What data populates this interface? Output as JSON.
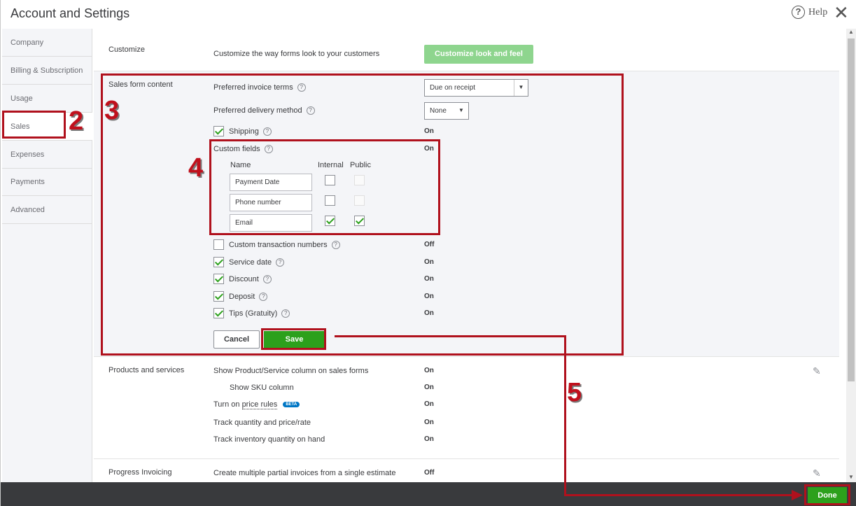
{
  "header": {
    "title": "Account and Settings",
    "help_label": "Help",
    "help_symbol": "?",
    "close_symbol": "✕"
  },
  "sidebar": {
    "items": [
      {
        "label": "Company"
      },
      {
        "label": "Billing & Subscription"
      },
      {
        "label": "Usage"
      },
      {
        "label": "Sales",
        "active": true
      },
      {
        "label": "Expenses"
      },
      {
        "label": "Payments"
      },
      {
        "label": "Advanced"
      }
    ]
  },
  "customize": {
    "section_label": "Customize",
    "description": "Customize the way forms look to your customers",
    "button_label": "Customize look and feel"
  },
  "sales_form": {
    "section_label": "Sales form content",
    "invoice_terms": {
      "label": "Preferred invoice terms",
      "value": "Due on receipt"
    },
    "delivery_method": {
      "label": "Preferred delivery method",
      "value": "None"
    },
    "shipping": {
      "label": "Shipping",
      "status": "On",
      "checked": true
    },
    "custom_fields": {
      "label": "Custom fields",
      "status": "On",
      "col_name": "Name",
      "col_internal": "Internal",
      "col_public": "Public",
      "rows": [
        {
          "name": "Payment Date",
          "internal": false,
          "public": false
        },
        {
          "name": "Phone number",
          "internal": false,
          "public": false
        },
        {
          "name": "Email",
          "internal": true,
          "public": true
        }
      ]
    },
    "options": [
      {
        "label": "Custom transaction numbers",
        "status": "Off",
        "checked": false
      },
      {
        "label": "Service date",
        "status": "On",
        "checked": true
      },
      {
        "label": "Discount",
        "status": "On",
        "checked": true
      },
      {
        "label": "Deposit",
        "status": "On",
        "checked": true
      },
      {
        "label": "Tips (Gratuity)",
        "status": "On",
        "checked": true
      }
    ],
    "cancel_label": "Cancel",
    "save_label": "Save"
  },
  "products": {
    "section_label": "Products and services",
    "rows": [
      {
        "label": "Show Product/Service column on sales forms",
        "status": "On"
      },
      {
        "label": "Show SKU column",
        "status": "On"
      },
      {
        "label_prefix": "Turn on ",
        "label_link": "price rules",
        "badge": "BETA",
        "status": "On"
      },
      {
        "label": "Track quantity and price/rate",
        "status": "On"
      },
      {
        "label": "Track inventory quantity on hand",
        "status": "On"
      }
    ]
  },
  "progress": {
    "section_label": "Progress Invoicing",
    "description": "Create multiple partial invoices from a single estimate",
    "status": "Off"
  },
  "footer": {
    "done_label": "Done"
  },
  "annotations": {
    "step2": "2",
    "step3": "3",
    "step4": "4",
    "step5": "5",
    "color": "#b0111d"
  },
  "icons": [
    "help-circle-icon",
    "close-icon",
    "question-icon",
    "checkbox-icon",
    "caret-down-icon",
    "pencil-icon"
  ]
}
